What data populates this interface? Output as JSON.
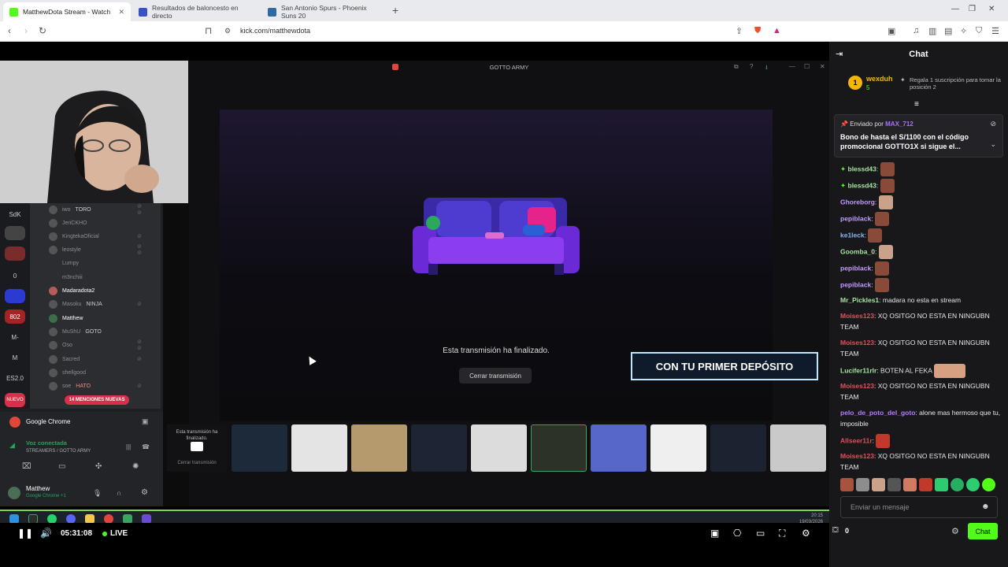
{
  "browser": {
    "tabs": [
      {
        "title": "MatthewDota Stream - Watch"
      },
      {
        "title": "Resultados de baloncesto en directo"
      },
      {
        "title": "San Antonio Spurs - Phoenix Suns 20"
      }
    ],
    "url": "kick.com/matthewdota"
  },
  "stream": {
    "discord": {
      "members": [
        {
          "name": "iwo",
          "tag": "TORO"
        },
        {
          "name": "JeriCKHO"
        },
        {
          "name": "KingtekaOficial"
        },
        {
          "name": "leostyle"
        },
        {
          "name": "Lumpy"
        },
        {
          "name": "m3nchiii"
        },
        {
          "name": "Madaradota2"
        },
        {
          "name": "Masoku",
          "tag": "NINJA"
        },
        {
          "name": "Matthew"
        },
        {
          "name": "MuShU",
          "tag": "GOTO"
        },
        {
          "name": "Oso"
        },
        {
          "name": "Sacred"
        },
        {
          "name": "shellgood"
        },
        {
          "name": "soe",
          "tag": "HATO"
        }
      ],
      "servers": [
        "SdK",
        "0",
        "802",
        "M-",
        "M",
        "ES2.0",
        "NUEVO"
      ],
      "mentions_pill": "14 MENCIONES NUEVAS",
      "voice": {
        "app": "Google Chrome",
        "status": "Voz conectada",
        "channel": "STREAMERS / GOTTO ARMY",
        "user": "Matthew",
        "user_sub": "Google Chrome +1"
      }
    },
    "stage_title": "GOTTO ARMY",
    "end_text": "Esta transmisión ha finalizado.",
    "end_button": "Cerrar transmisión",
    "promo_text": "CON TU PRIMER DEPÓSITO",
    "thumb_label": "Esta transmisión ha finalizado.",
    "thumb_button": "Cerrar transmisión",
    "clock": {
      "time": "20:15",
      "date": "19/03/2026"
    }
  },
  "player": {
    "time": "05:31:08",
    "live_label": "LIVE"
  },
  "chat": {
    "title": "Chat",
    "leader": {
      "rank": "1",
      "name": "wexduh",
      "count": "5",
      "note": "Regala 1 suscripción para tomar la posición 2"
    },
    "pinned": {
      "by_label": "Enviado por",
      "by_user": "MAX_712",
      "text": "Bono de hasta el S/1100 con el código promocional GOTTO1X si sigue el..."
    },
    "messages": [
      {
        "user": "blessd43",
        "text": "",
        "color": "#a6e3a1"
      },
      {
        "user": "blessd43",
        "text": "",
        "color": "#a6e3a1"
      },
      {
        "user": "Ghoreborg",
        "text": "",
        "color": "#c39bff"
      },
      {
        "user": "pepiblack",
        "text": "",
        "color": "#c39bff"
      },
      {
        "user": "ke1leck",
        "text": "",
        "color": "#8ab4f8"
      },
      {
        "user": "Goomba_0",
        "text": "",
        "color": "#a6e3a1"
      },
      {
        "user": "pepiblack",
        "text": "",
        "color": "#c39bff"
      },
      {
        "user": "pepiblack",
        "text": "",
        "color": "#c39bff"
      },
      {
        "user": "Mr_Pickles1",
        "text": "madara no esta en stream",
        "color": "#a6e3a1"
      },
      {
        "user": "Moises123",
        "text": "XQ OSITGO NO ESTA EN NINGUBN TEAM",
        "color": "#e0505a"
      },
      {
        "user": "Moises123",
        "text": "XQ OSITGO NO ESTA EN NINGUBN TEAM",
        "color": "#e0505a"
      },
      {
        "user": "Lucifer11rlr",
        "text": "BOTEN AL FEKA",
        "color": "#a6e3a1"
      },
      {
        "user": "Moises123",
        "text": "XQ OSITGO NO ESTA EN NINGUBN TEAM",
        "color": "#e0505a"
      },
      {
        "user": "pelo_de_poto_del_goto",
        "text": "alone mas hermoso que tu, imposible",
        "color": "#b37bff"
      },
      {
        "user": "Allseer11r",
        "text": "",
        "color": "#e0505a"
      },
      {
        "user": "Moises123",
        "text": "XQ OSITGO NO ESTA EN NINGUBN TEAM",
        "color": "#e0505a"
      }
    ],
    "input_placeholder": "Enviar un mensaje",
    "points": "0",
    "send_label": "Chat"
  }
}
